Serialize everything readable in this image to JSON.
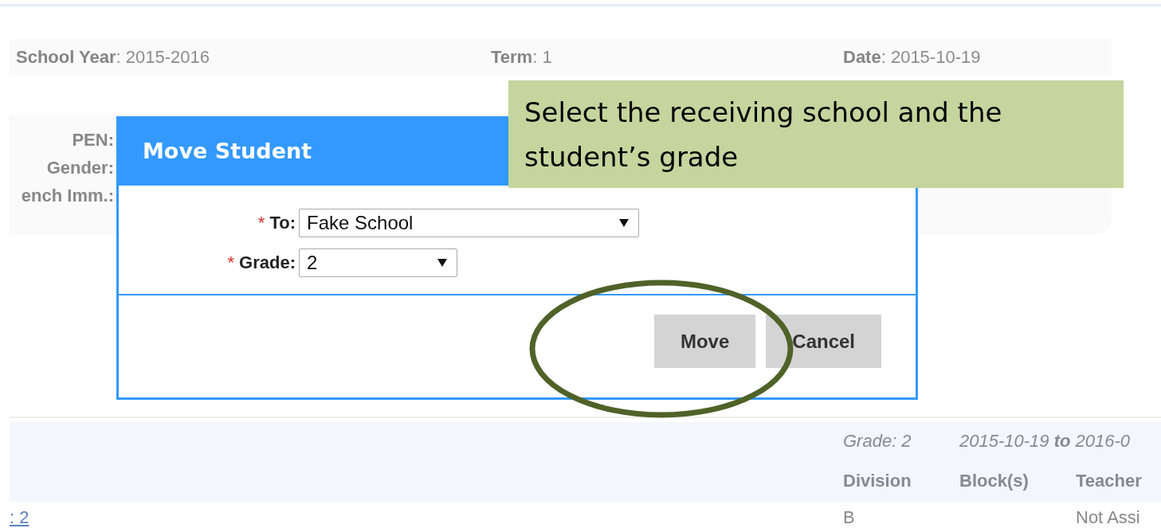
{
  "page": {
    "info_bar": [
      "**School Year**: 2015-2016",
      "**Term**: 1",
      "**Date**: 2015-10-19"
    ],
    "student_card": {
      "labels": [
        "PEN:",
        "Gender:",
        "ench Imm.:"
      ]
    },
    "enrollment": {
      "grade": "Grade: 2",
      "dates": "2015-10-19 **to** 2016-0",
      "columns": [
        "Division",
        "Block(s)",
        "Teacher"
      ],
      "row": {
        "link": ": 2",
        "division": "B",
        "teacher": "Not Assi"
      }
    }
  },
  "dialog": {
    "title": "Move Student",
    "fields": [
      {
        "required_mark": "*",
        "label": "To:",
        "value": "Fake School",
        "kind": "wide"
      },
      {
        "required_mark": "*",
        "label": "Grade:",
        "value": "2",
        "kind": "narrow"
      }
    ],
    "buttons": [
      "Move",
      "Cancel"
    ]
  },
  "callout": {
    "text": "Select the receiving school and the student’s grade"
  }
}
